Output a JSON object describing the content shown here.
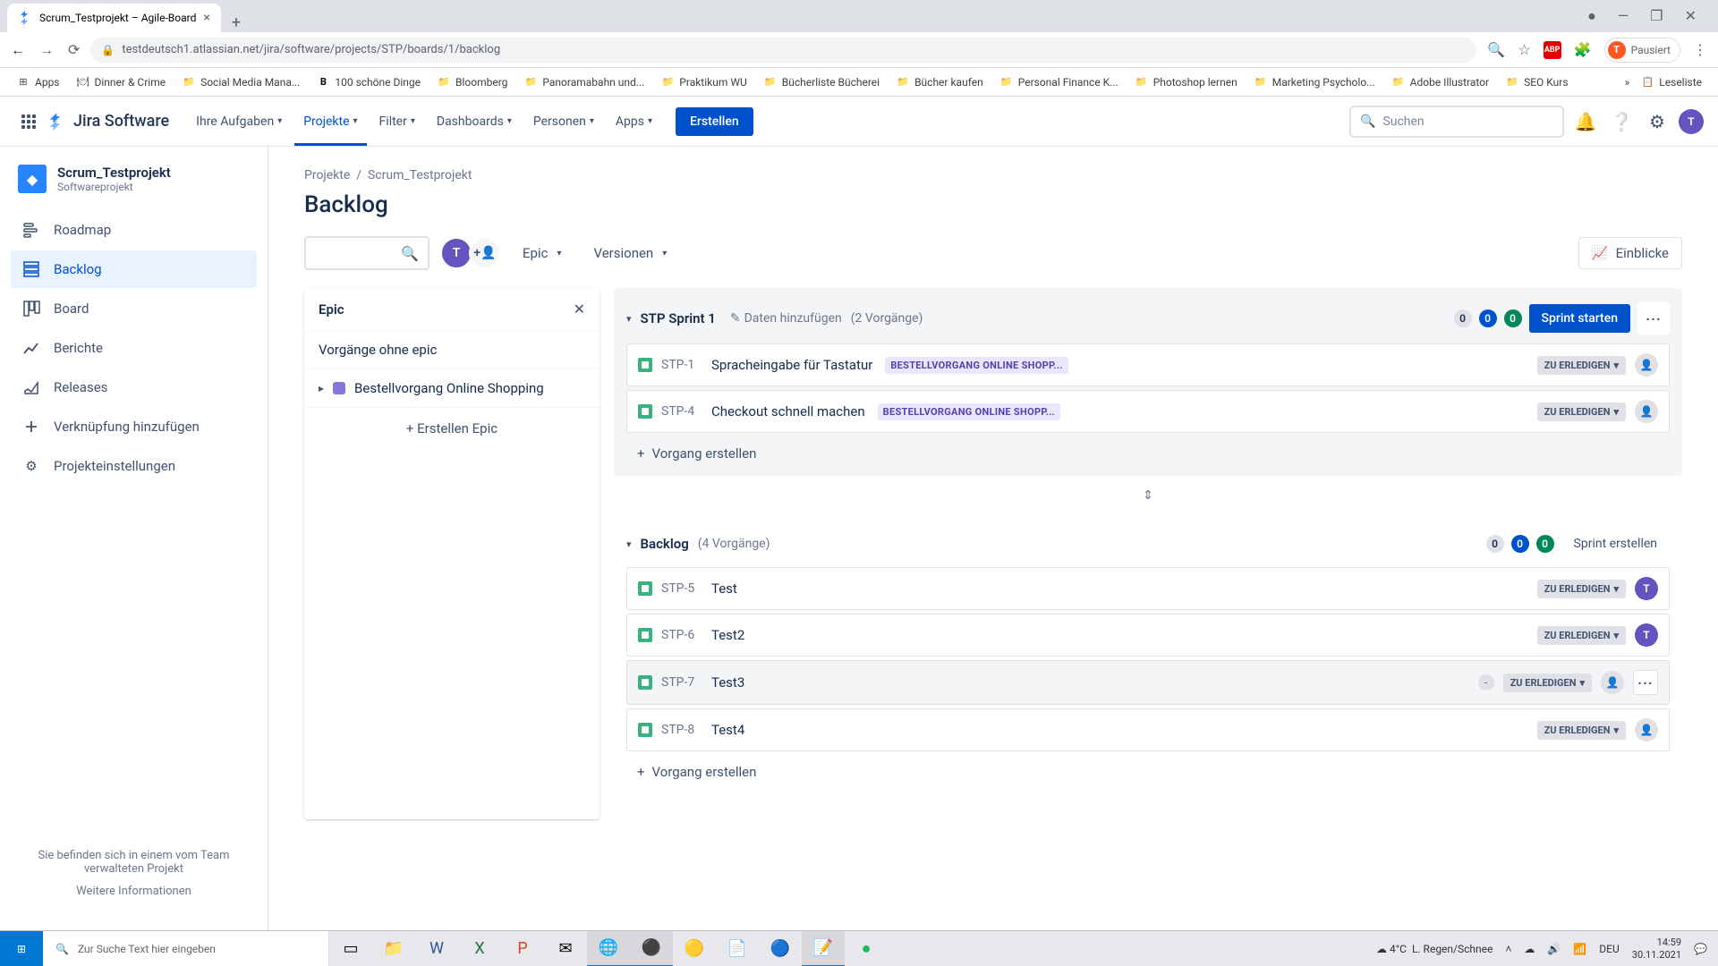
{
  "browser": {
    "tab_title": "Scrum_Testprojekt – Agile-Board",
    "url": "testdeutsch1.atlassian.net/jira/software/projects/STP/boards/1/backlog",
    "profile_status": "Pausiert",
    "profile_initial": "T",
    "bookmarks": [
      "Apps",
      "Dinner & Crime",
      "Social Media Mana...",
      "100 schöne Dinge",
      "Bloomberg",
      "Panoramabahn und...",
      "Praktikum WU",
      "Bücherliste Bücherei",
      "Bücher kaufen",
      "Personal Finance K...",
      "Photoshop lernen",
      "Marketing Psycholo...",
      "Adobe Illustrator",
      "SEO Kurs"
    ],
    "reading_list": "Leseliste"
  },
  "jira": {
    "logo_text": "Jira Software",
    "nav": [
      "Ihre Aufgaben",
      "Projekte",
      "Filter",
      "Dashboards",
      "Personen",
      "Apps"
    ],
    "create_btn": "Erstellen",
    "search_placeholder": "Suchen",
    "avatar_initial": "T"
  },
  "sidebar": {
    "project_name": "Scrum_Testprojekt",
    "project_type": "Softwareprojekt",
    "items": [
      "Roadmap",
      "Backlog",
      "Board",
      "Berichte",
      "Releases",
      "Verknüpfung hinzufügen",
      "Projekteinstellungen"
    ],
    "footer_text": "Sie befinden sich in einem vom Team verwalteten Projekt",
    "footer_link": "Weitere Informationen"
  },
  "breadcrumb": {
    "projects": "Projekte",
    "project": "Scrum_Testprojekt"
  },
  "page_title": "Backlog",
  "toolbar": {
    "epic_filter": "Epic",
    "versions_filter": "Versionen",
    "insights": "Einblicke"
  },
  "epic_panel": {
    "title": "Epic",
    "no_epic": "Vorgänge ohne epic",
    "epic1": "Bestellvorgang Online Shopping",
    "create": "Erstellen Epic"
  },
  "sprint": {
    "title": "STP Sprint 1",
    "add_data": "Daten hinzufügen",
    "count": "(2 Vorgänge)",
    "badges": [
      "0",
      "0",
      "0"
    ],
    "start_btn": "Sprint starten",
    "issues": [
      {
        "key": "STP-1",
        "summary": "Spracheingabe für Tastatur",
        "epic": "BESTELLVORGANG ONLINE SHOPP...",
        "status": "ZU ERLEDIGEN",
        "assignee": "unassigned"
      },
      {
        "key": "STP-4",
        "summary": "Checkout schnell machen",
        "epic": "BESTELLVORGANG ONLINE SHOPP...",
        "status": "ZU ERLEDIGEN",
        "assignee": "unassigned"
      }
    ],
    "create_issue": "Vorgang erstellen"
  },
  "backlog": {
    "title": "Backlog",
    "count": "(4 Vorgänge)",
    "badges": [
      "0",
      "0",
      "0"
    ],
    "create_sprint_btn": "Sprint erstellen",
    "issues": [
      {
        "key": "STP-5",
        "summary": "Test",
        "status": "ZU ERLEDIGEN",
        "assignee": "T"
      },
      {
        "key": "STP-6",
        "summary": "Test2",
        "status": "ZU ERLEDIGEN",
        "assignee": "T"
      },
      {
        "key": "STP-7",
        "summary": "Test3",
        "status": "ZU ERLEDIGEN",
        "assignee": "unassigned",
        "hover": true,
        "points": "-"
      },
      {
        "key": "STP-8",
        "summary": "Test4",
        "status": "ZU ERLEDIGEN",
        "assignee": "unassigned"
      }
    ],
    "create_issue": "Vorgang erstellen"
  },
  "taskbar": {
    "search_placeholder": "Zur Suche Text hier eingeben",
    "weather_temp": "4°C",
    "weather_desc": "L. Regen/Schnee",
    "lang": "DEU",
    "time": "14:59",
    "date": "30.11.2021"
  }
}
